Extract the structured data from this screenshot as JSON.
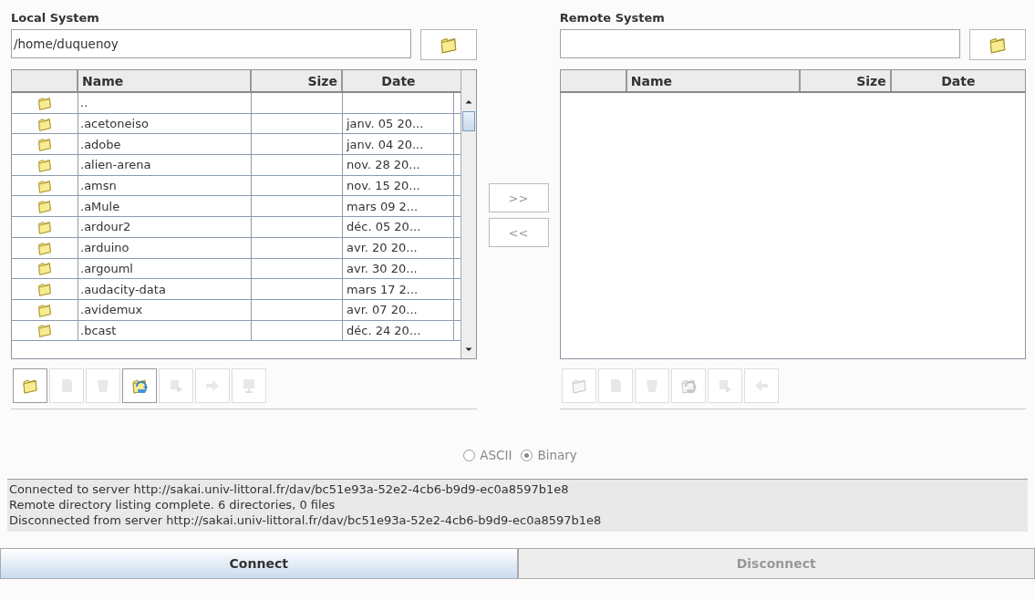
{
  "local": {
    "title": "Local System",
    "path": "/home/duquenoy",
    "columns": [
      "Name",
      "Size",
      "Date"
    ],
    "rows": [
      {
        "name": ".."
      },
      {
        "name": ".acetoneiso",
        "date": "janv. 05 20..."
      },
      {
        "name": ".adobe",
        "date": "janv. 04 20..."
      },
      {
        "name": ".alien-arena",
        "date": "nov. 28 20..."
      },
      {
        "name": ".amsn",
        "date": "nov. 15 20..."
      },
      {
        "name": ".aMule",
        "date": "mars 09 2..."
      },
      {
        "name": ".ardour2",
        "date": "déc. 05 20..."
      },
      {
        "name": ".arduino",
        "date": "avr. 20 20..."
      },
      {
        "name": ".argouml",
        "date": "avr. 30 20..."
      },
      {
        "name": ".audacity-data",
        "date": "mars 17 2..."
      },
      {
        "name": ".avidemux",
        "date": "avr. 07 20..."
      },
      {
        "name": ".bcast",
        "date": "déc. 24 20..."
      }
    ],
    "tools": [
      {
        "kind": "folder",
        "disabled": false
      },
      {
        "kind": "document",
        "disabled": true
      },
      {
        "kind": "trash",
        "disabled": true
      },
      {
        "kind": "refresh",
        "disabled": false
      },
      {
        "kind": "export",
        "disabled": true
      },
      {
        "kind": "right",
        "disabled": true
      },
      {
        "kind": "computer",
        "disabled": true
      }
    ]
  },
  "transfer": [
    {
      "label": ">>",
      "disabled": true
    },
    {
      "label": "<<",
      "disabled": true
    }
  ],
  "remote": {
    "title": "Remote System",
    "columns": [
      "Name",
      "Size",
      "Date"
    ],
    "tools": [
      {
        "kind": "folder",
        "disabled": true
      },
      {
        "kind": "document",
        "disabled": true
      },
      {
        "kind": "trash",
        "disabled": true
      },
      {
        "kind": "refresh",
        "disabled": true
      },
      {
        "kind": "export",
        "disabled": true
      },
      {
        "kind": "left",
        "disabled": true
      }
    ]
  },
  "mode": [
    {
      "label": "ASCII",
      "selected": false
    },
    {
      "label": "Binary",
      "selected": true
    }
  ],
  "log": [
    "Connected to server http://sakai.univ-littoral.fr/dav/bc51e93a-52e2-4cb6-b9d9-ec0a8597b1e8",
    "Remote directory listing complete. 6 directories, 0 files",
    "Disconnected from server http://sakai.univ-littoral.fr/dav/bc51e93a-52e2-4cb6-b9d9-ec0a8597b1e8"
  ],
  "actions": [
    {
      "label": "Connect",
      "disabled": false
    },
    {
      "label": "Disconnect",
      "disabled": true
    }
  ]
}
